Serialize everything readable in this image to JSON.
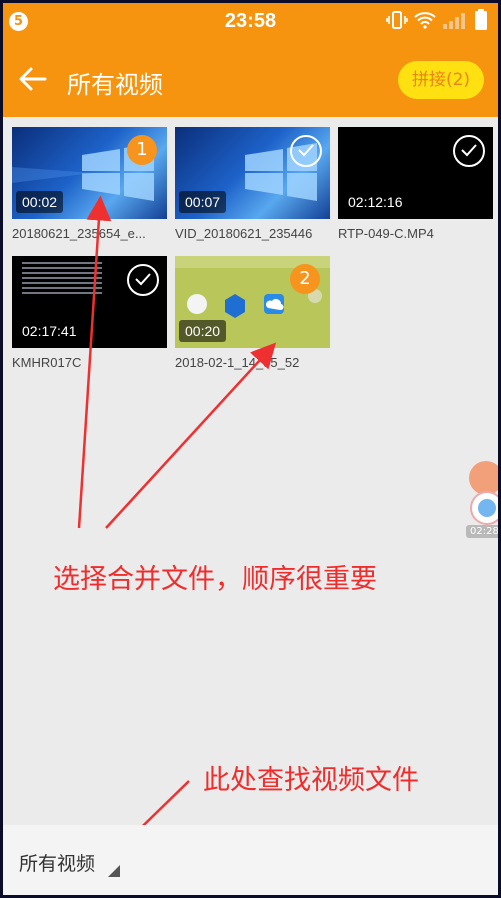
{
  "status_bar": {
    "notification_count": "5",
    "time": "23:58"
  },
  "app_bar": {
    "title": "所有视频",
    "join_button": "拼接(2)"
  },
  "videos": [
    {
      "name": "20180621_235654_e...",
      "duration": "00:02",
      "selected": true,
      "order": "1"
    },
    {
      "name": "VID_20180621_235446",
      "duration": "00:07",
      "selected": false
    },
    {
      "name": "RTP-049-C.MP4",
      "duration": "02:12:16",
      "selected": false
    },
    {
      "name": "KMHR017C",
      "duration": "02:17:41",
      "selected": false
    },
    {
      "name": "2018-02-1_14_55_52",
      "duration": "00:20",
      "selected": true,
      "order": "2"
    }
  ],
  "floating": {
    "time": "02:28"
  },
  "annotations": {
    "select": "选择合并文件，顺序很重要",
    "find": "此处查找视频文件"
  },
  "footer": {
    "folder": "所有视频"
  },
  "colors": {
    "accent": "#f7940f",
    "join_bg": "#ffe011",
    "annotation": "#ef2d2d"
  }
}
